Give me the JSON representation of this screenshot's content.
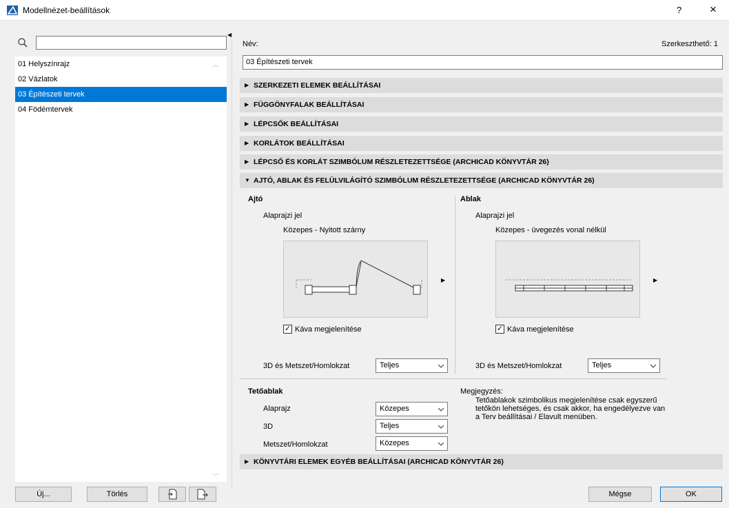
{
  "window": {
    "title": "Modellnézet-beállítások",
    "help_label": "?",
    "close_label": "×"
  },
  "left": {
    "search_placeholder": "",
    "items": [
      {
        "label": "01 Helyszínrajz"
      },
      {
        "label": "02 Vázlatok"
      },
      {
        "label": "03 Építészeti tervek",
        "selected": true
      },
      {
        "label": "04 Födémtervek"
      }
    ],
    "new_label": "Új...",
    "delete_label": "Törlés"
  },
  "main": {
    "name_label": "Név:",
    "editable_label": "Szerkeszthető: 1",
    "name_value": "03 Építészeti tervek",
    "sections": [
      "SZERKEZETI ELEMEK BEÁLLÍTÁSAI",
      "FÜGGÖNYFALAK BEÁLLÍTÁSAI",
      "LÉPCSŐK BEÁLLÍTÁSAI",
      "KORLÁTOK BEÁLLÍTÁSAI",
      "LÉPCSŐ ÉS KORLÁT SZIMBÓLUM RÉSZLETEZETTSÉGE (ARCHICAD KÖNYVTÁR 26)",
      "AJTÓ, ABLAK ÉS FELÜLVILÁGÍTÓ SZIMBÓLUM RÉSZLETEZETTSÉGE (ARCHICAD KÖNYVTÁR 26)",
      "KÖNYVTÁRI ELEMEK EGYÉB BEÁLLÍTÁSAI (ARCHICAD KÖNYVTÁR 26)"
    ],
    "door": {
      "heading": "Ajtó",
      "plan_label": "Alaprajzi jel",
      "symbol_label": "Közepes - Nyitott szárny",
      "checkbox_label": "Káva megjelenítése",
      "checked": true,
      "section_label": "3D és Metszet/Homlokzat",
      "section_value": "Teljes"
    },
    "window_cfg": {
      "heading": "Ablak",
      "plan_label": "Alaprajzi jel",
      "symbol_label": "Közepes - üvegezés vonal nélkül",
      "checkbox_label": "Káva megjelenítése",
      "checked": true,
      "section_label": "3D és Metszet/Homlokzat",
      "section_value": "Teljes"
    },
    "skylight": {
      "heading": "Tetőablak",
      "rows": [
        {
          "label": "Alaprajz",
          "value": "Közepes"
        },
        {
          "label": "3D",
          "value": "Teljes"
        },
        {
          "label": "Metszet/Homlokzat",
          "value": "Közepes"
        }
      ]
    },
    "note": {
      "heading": "Megjegyzés:",
      "text": "Tetőablakok szimbolikus megjelenítése csak egyszerű tetőkön lehetséges, és csak akkor, ha engedélyezve van a Terv beállításai / Elavult menüben."
    }
  },
  "footer": {
    "cancel_label": "Mégse",
    "ok_label": "OK"
  },
  "colors": {
    "accent": "#0078d7",
    "section_bg": "#dcdcdc",
    "panel_bg": "#f0f0f0"
  }
}
